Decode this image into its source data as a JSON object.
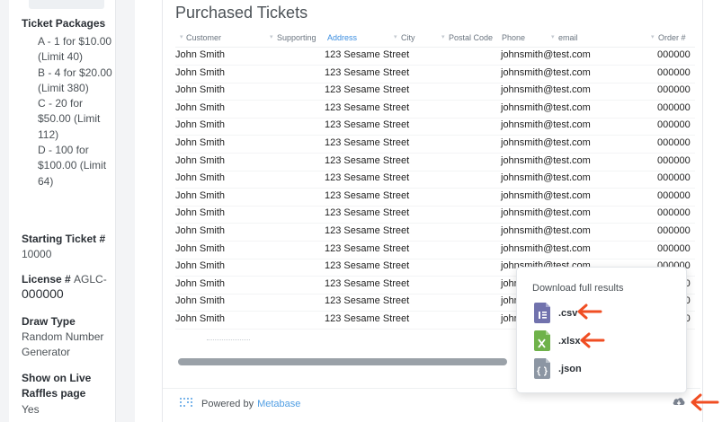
{
  "sidebar": {
    "packages_label": "Ticket Packages",
    "packages": [
      "A - 1 for $10.00 (Limit 40)",
      "B - 4 for $20.00 (Limit 380)",
      "C - 20 for $50.00 (Limit 112)",
      "D - 100 for $100.00 (Limit 64)"
    ],
    "starting_ticket_label": "Starting Ticket #",
    "starting_ticket_value": "10000",
    "license_label": "License #",
    "license_prefix": "AGLC-",
    "license_value": "000000",
    "draw_type_label": "Draw Type",
    "draw_type_value": "Random Number Generator",
    "live_label": "Show on Live Raffles page",
    "live_value": "Yes"
  },
  "card": {
    "title": "Purchased Tickets",
    "columns": [
      "Customer",
      "Supporting",
      "Address",
      "City",
      "Postal Code",
      "Phone",
      "email",
      "Order #"
    ],
    "sorted_column": "Address",
    "rows": [
      {
        "customer": "John Smith",
        "address": "123 Sesame Street",
        "email": "johnsmith@test.com",
        "order": "000000"
      },
      {
        "customer": "John Smith",
        "address": "123 Sesame Street",
        "email": "johnsmith@test.com",
        "order": "000000"
      },
      {
        "customer": "John Smith",
        "address": "123 Sesame Street",
        "email": "johnsmith@test.com",
        "order": "000000"
      },
      {
        "customer": "John Smith",
        "address": "123 Sesame Street",
        "email": "johnsmith@test.com",
        "order": "000000"
      },
      {
        "customer": "John Smith",
        "address": "123 Sesame Street",
        "email": "johnsmith@test.com",
        "order": "000000"
      },
      {
        "customer": "John Smith",
        "address": "123 Sesame Street",
        "email": "johnsmith@test.com",
        "order": "000000"
      },
      {
        "customer": "John Smith",
        "address": "123 Sesame Street",
        "email": "johnsmith@test.com",
        "order": "000000"
      },
      {
        "customer": "John Smith",
        "address": "123 Sesame Street",
        "email": "johnsmith@test.com",
        "order": "000000"
      },
      {
        "customer": "John Smith",
        "address": "123 Sesame Street",
        "email": "johnsmith@test.com",
        "order": "000000"
      },
      {
        "customer": "John Smith",
        "address": "123 Sesame Street",
        "email": "johnsmith@test.com",
        "order": "000000"
      },
      {
        "customer": "John Smith",
        "address": "123 Sesame Street",
        "email": "johnsmith@test.com",
        "order": "000000"
      },
      {
        "customer": "John Smith",
        "address": "123 Sesame Street",
        "email": "johnsmith@test.com",
        "order": "000000"
      },
      {
        "customer": "John Smith",
        "address": "123 Sesame Street",
        "email": "johnsmith@test.com",
        "order": "000000"
      },
      {
        "customer": "John Smith",
        "address": "123 Sesame Street",
        "email": "johnsmith@test.com",
        "order": "000000"
      },
      {
        "customer": "John Smith",
        "address": "123 Sesame Street",
        "email": "johnsmith@test.com",
        "order": "000000"
      },
      {
        "customer": "John Smith",
        "address": "123 Sesame Street",
        "email": "johnsmith@test.com",
        "order": "000000"
      }
    ]
  },
  "footer": {
    "powered_by": "Powered by",
    "brand": "Metabase"
  },
  "download_popover": {
    "title": "Download full results",
    "formats": [
      ".csv",
      ".xlsx",
      ".json"
    ]
  },
  "icons": {
    "download": "cloud-download-icon",
    "arrow": "arrow-left-icon",
    "csv": "csv-file-icon",
    "xlsx": "xlsx-file-icon",
    "json": "json-file-icon",
    "logo": "metabase-logo-icon"
  },
  "colors": {
    "accent": "#509ee3",
    "annotation_arrow": "#f04e23",
    "csv": "#7172ad",
    "xlsx": "#6fb24a",
    "json": "#8c96a3"
  }
}
